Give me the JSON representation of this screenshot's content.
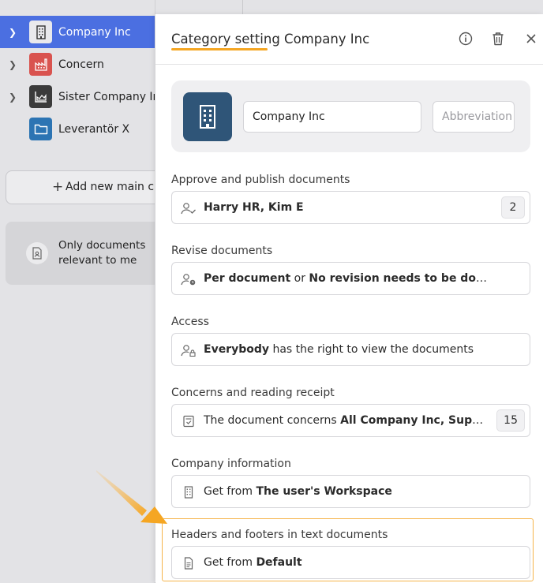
{
  "sidebar": {
    "items": [
      {
        "label": "Company Inc",
        "icon": "building-icon",
        "icon_bg": "#e9e9ec",
        "active": true,
        "expandable": true
      },
      {
        "label": "Concern",
        "icon": "factory-icon",
        "icon_bg": "#d9534f",
        "active": false,
        "expandable": true
      },
      {
        "label": "Sister Company Inc",
        "icon": "chart-icon",
        "icon_bg": "#3b3b3b",
        "active": false,
        "expandable": true
      },
      {
        "label": "Leverantör X",
        "icon": "folder-icon",
        "icon_bg": "#2c74b3",
        "active": false,
        "expandable": false
      }
    ],
    "add_button_label": "Add new main category",
    "filter_label": "Only documents relevant to me"
  },
  "panel": {
    "title": "Category setting Company Inc",
    "name_value": "Company Inc",
    "abbreviation_placeholder": "Abbreviation",
    "sections": {
      "approve": {
        "label": "Approve and publish documents",
        "text": "Harry HR, Kim E",
        "count": "2"
      },
      "revise": {
        "label": "Revise documents",
        "bold1": "Per document",
        "mid": " or ",
        "bold2": "No revision needs to be done"
      },
      "access": {
        "label": "Access",
        "bold": "Everybody",
        "rest": " has the right to view the documents"
      },
      "concerns": {
        "label": "Concerns and reading receipt",
        "prefix": "The document concerns ",
        "bold": "All Company Inc, Supplier, Manager",
        "count": "15"
      },
      "company_info": {
        "label": "Company information",
        "prefix": "Get from ",
        "bold": "The user's Workspace"
      },
      "headers_footers": {
        "label": "Headers and footers in text documents",
        "prefix": "Get from ",
        "bold": "Default"
      }
    }
  },
  "colors": {
    "accent": "#4b6fe1",
    "highlight": "#f5a623",
    "company_icon_bg": "#2f5578"
  }
}
